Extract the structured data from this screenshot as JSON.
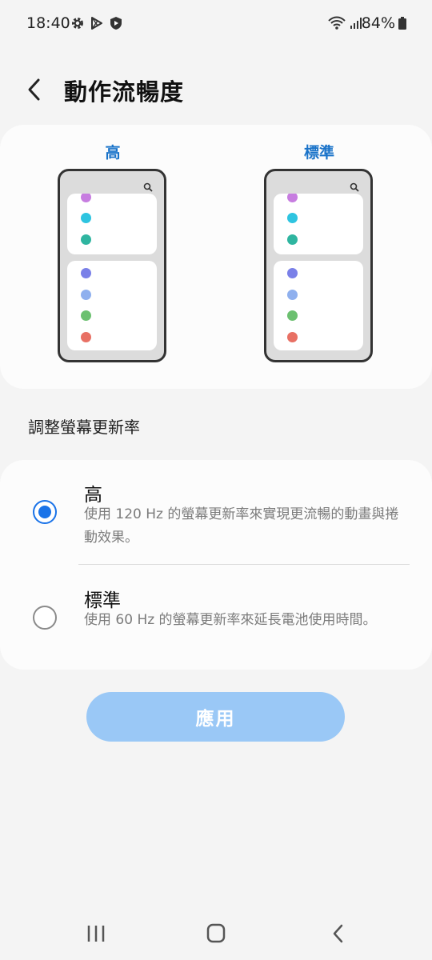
{
  "status_bar": {
    "time": "18:40",
    "battery": "84%",
    "icons": [
      "gear-icon",
      "play-store-icon",
      "shield-icon",
      "wifi-icon",
      "signal-icon",
      "battery-icon"
    ]
  },
  "header": {
    "title": "動作流暢度",
    "back_icon": "chevron-left-icon"
  },
  "preview": {
    "high_label": "高",
    "standard_label": "標準",
    "dot_colors_top": [
      "#c77de0",
      "#2ec4e0",
      "#2fb5a0"
    ],
    "dot_colors_bottom": [
      "#7a80e8",
      "#8fb0ee",
      "#6cc070",
      "#e87064"
    ]
  },
  "section_label": "調整螢幕更新率",
  "options": [
    {
      "title": "高",
      "description": "使用 120 Hz 的螢幕更新率來實現更流暢的動畫與捲動效果。",
      "selected": true
    },
    {
      "title": "標準",
      "description": "使用 60 Hz 的螢幕更新率來延長電池使用時間。",
      "selected": false
    }
  ],
  "apply_button": "應用",
  "accent_color": "#1a73e8",
  "nav_bar": {
    "icons": [
      "recent-apps-icon",
      "home-icon",
      "back-icon"
    ]
  }
}
